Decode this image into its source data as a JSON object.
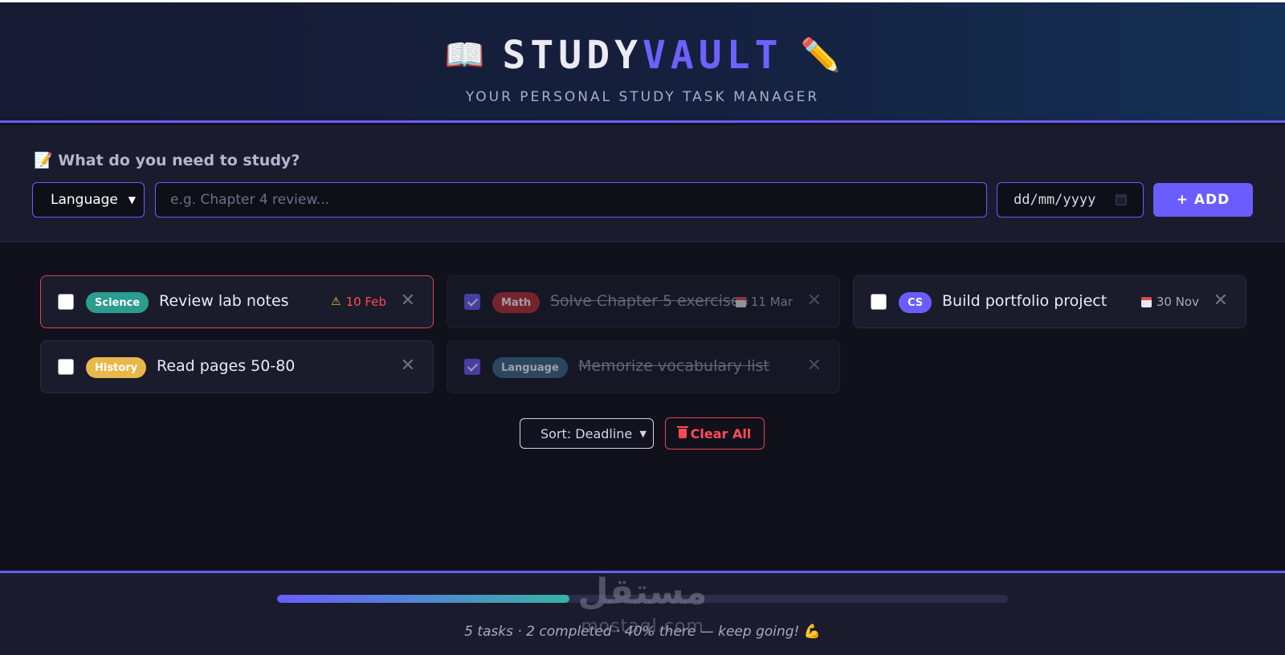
{
  "header": {
    "title_main": "STUDY",
    "title_accent": "VAULT",
    "book_emoji": "📖",
    "pencil_emoji": "✏️",
    "subtitle": "YOUR PERSONAL STUDY TASK MANAGER"
  },
  "form": {
    "prompt_emoji": "📝",
    "prompt": "What do you need to study?",
    "category_value": "Language",
    "task_placeholder": "e.g. Chapter 4 review...",
    "date_placeholder": "dd/mm/yyyy",
    "add_label": "+ ADD"
  },
  "tasks": [
    {
      "tag": "Science",
      "tag_color": "#2b9d8f",
      "text": "Review lab notes",
      "deadline": "10 Feb",
      "overdue": true,
      "done": false
    },
    {
      "tag": "Math",
      "tag_color": "#b8313b",
      "text": "Solve Chapter 5 exercises",
      "deadline": "11 Mar",
      "overdue": false,
      "done": true
    },
    {
      "tag": "CS",
      "tag_color": "#6a5cff",
      "text": "Build portfolio project",
      "deadline": "30 Nov",
      "overdue": false,
      "done": false
    },
    {
      "tag": "History",
      "tag_color": "#e8b84a",
      "text": "Read pages 50-80",
      "deadline": "",
      "overdue": false,
      "done": false
    },
    {
      "tag": "Language",
      "tag_color": "#3d6a8e",
      "text": "Memorize vocabulary list",
      "deadline": "",
      "overdue": false,
      "done": true
    }
  ],
  "controls": {
    "sort_label": "Sort: Deadline",
    "clear_label": "Clear All"
  },
  "footer": {
    "progress_fraction": 0.4,
    "progress_text": "5 tasks · 2 completed · 40% there — keep going!",
    "progress_emoji": "💪"
  },
  "watermark": {
    "arabic": "مستقل",
    "latin": "mostaql.com"
  }
}
